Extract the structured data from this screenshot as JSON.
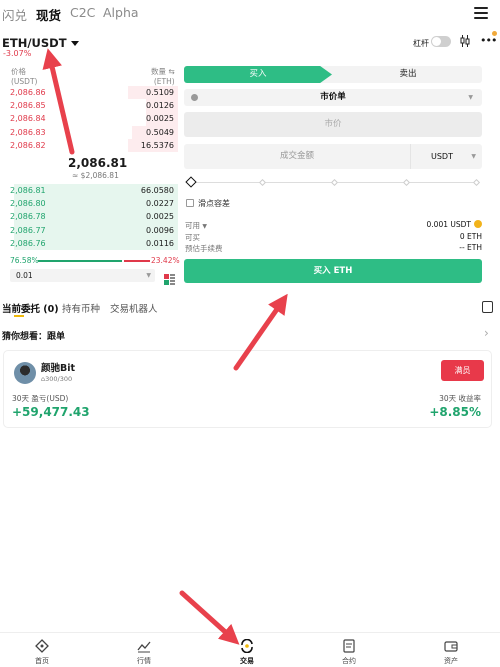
{
  "top_tabs": [
    "闪兑",
    "现货",
    "C2C",
    "Alpha"
  ],
  "active_top_tab": "现货",
  "pair": {
    "name": "ETH/USDT",
    "change": "-3.07%",
    "leverage_label": "杠杆"
  },
  "order_book": {
    "price_header": "价格",
    "price_unit": "(USDT)",
    "qty_header": "数量 ⇆",
    "qty_unit": "(ETH)",
    "asks": [
      {
        "price": "2,086.86",
        "qty": "0.5109",
        "depth": 0.28
      },
      {
        "price": "2,086.85",
        "qty": "0.0126",
        "depth": 0.18
      },
      {
        "price": "2,086.84",
        "qty": "0.0025",
        "depth": 0.18
      },
      {
        "price": "2,086.83",
        "qty": "0.5049",
        "depth": 0.26
      },
      {
        "price": "2,086.82",
        "qty": "16.5376",
        "depth": 0.28
      }
    ],
    "mid_price": "2,086.81",
    "mid_usd": "≈ $2,086.81",
    "bids": [
      {
        "price": "2,086.81",
        "qty": "66.0580",
        "depth": 0.92
      },
      {
        "price": "2,086.80",
        "qty": "0.0227",
        "depth": 0.92
      },
      {
        "price": "2,086.78",
        "qty": "0.0025",
        "depth": 0.92
      },
      {
        "price": "2,086.77",
        "qty": "0.0096",
        "depth": 0.92
      },
      {
        "price": "2,086.76",
        "qty": "0.0116",
        "depth": 0.92
      }
    ],
    "buy_ratio": "76.58%",
    "sell_ratio": "23.42%",
    "depth_value": "0.01"
  },
  "trade": {
    "buy_tab": "买入",
    "sell_tab": "卖出",
    "order_type": "市价单",
    "price_placeholder": "市价",
    "amount_placeholder": "成交金额",
    "amount_unit": "USDT",
    "slippage_label": "滑点容差",
    "available_label": "可用",
    "available_value": "0.001 USDT",
    "can_buy_label": "可买",
    "can_buy_value": "0 ETH",
    "fee_label": "预估手续费",
    "fee_value": "-- ETH",
    "buy_button": "买入 ETH"
  },
  "lower_tabs": [
    "当前委托 (0)",
    "持有币种",
    "交易机器人"
  ],
  "guess_label": "猜你想看：跟单",
  "copy_card": {
    "name": "颜驰Bit",
    "followers": "300/300",
    "button": "满员",
    "pnl_label": "30天 盈亏(USD)",
    "pnl_value": "+59,477.43",
    "roi_label": "30天 收益率",
    "roi_value": "+8.85%"
  },
  "bottom_nav": [
    "首页",
    "行情",
    "交易",
    "合约",
    "资产"
  ],
  "colors": {
    "green": "#2ebd85",
    "red": "#e0394a",
    "arrow": "#e8414c"
  }
}
